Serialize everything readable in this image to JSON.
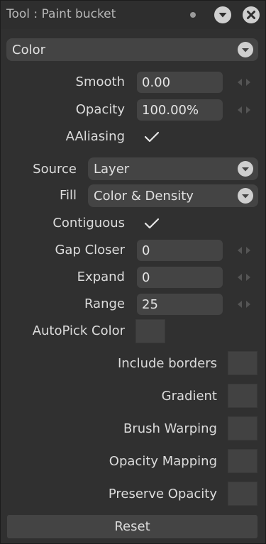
{
  "panel": {
    "title": "Tool : Paint bucket"
  },
  "mode_dropdown": {
    "value": "Color"
  },
  "smooth": {
    "label": "Smooth",
    "value": "0.00"
  },
  "opacity": {
    "label": "Opacity",
    "value": "100.00%"
  },
  "antialiasing": {
    "label": "AAliasing",
    "checked": true
  },
  "source": {
    "label": "Source",
    "value": "Layer"
  },
  "fill": {
    "label": "Fill",
    "value": "Color & Density"
  },
  "contiguous": {
    "label": "Contiguous",
    "checked": true
  },
  "gap_closer": {
    "label": "Gap Closer",
    "value": "0"
  },
  "expand": {
    "label": "Expand",
    "value": "0"
  },
  "range": {
    "label": "Range",
    "value": "25"
  },
  "autopick": {
    "label": "AutoPick Color"
  },
  "include_borders": {
    "label": "Include borders"
  },
  "gradient": {
    "label": "Gradient"
  },
  "brush_warping": {
    "label": "Brush Warping"
  },
  "opacity_mapping": {
    "label": "Opacity Mapping"
  },
  "preserve_opacity": {
    "label": "Preserve Opacity"
  },
  "reset_button": {
    "label": "Reset"
  },
  "colors": {
    "panel_bg": "#303030",
    "field_bg": "#444444",
    "text": "#dcdcdc",
    "icon": "#cfcfcf"
  }
}
